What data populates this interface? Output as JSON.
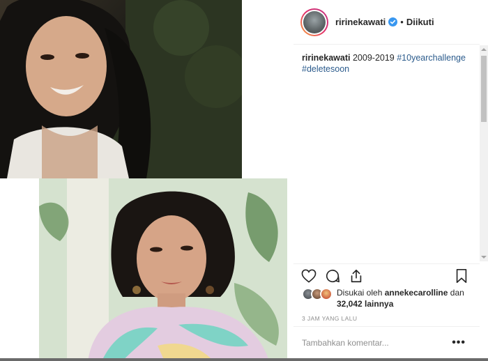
{
  "post": {
    "username": "ririnekawati",
    "verified": true,
    "follow_label": "Diikuti",
    "caption_user": "ririnekawati",
    "caption_text": "2009-2019",
    "hashtags": [
      "#10yearchallenge",
      "#deletesoon"
    ]
  },
  "actions": {
    "icons": [
      "heart-icon",
      "comment-icon",
      "share-icon",
      "bookmark-icon"
    ]
  },
  "likes": {
    "prefix": "Disukai oleh",
    "liker": "annekecarolline",
    "connector": "dan",
    "count": "32,042",
    "suffix": "lainnya"
  },
  "timestamp": "3 JAM YANG LALU",
  "comment": {
    "placeholder": "Tambahkan komentar...",
    "more_label": "•••"
  },
  "colors": {
    "accent_link": "#2b5b8c",
    "verified_blue": "#3897f0",
    "muted": "#8e8e8e"
  }
}
